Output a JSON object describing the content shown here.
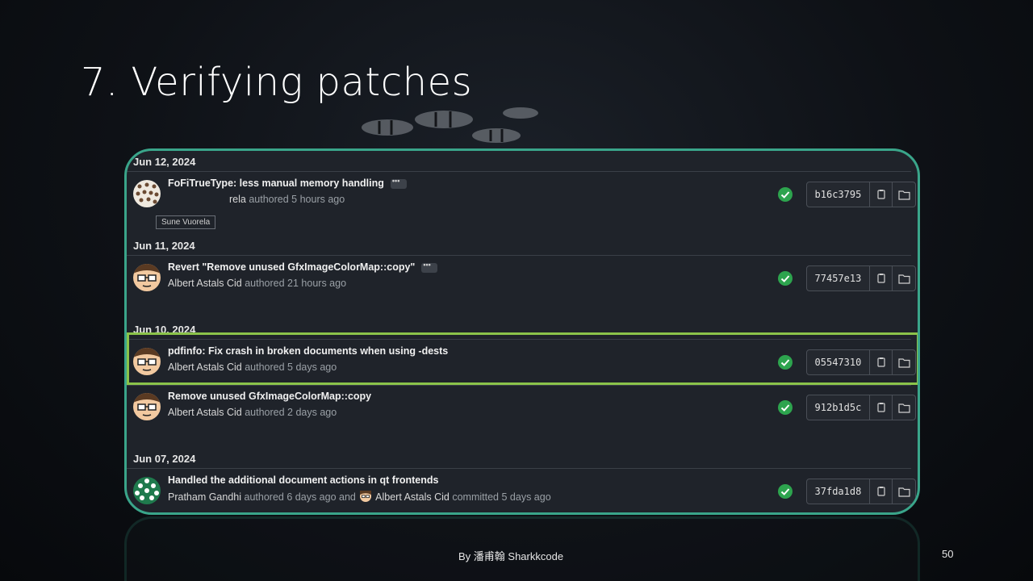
{
  "slide": {
    "title": "7. Verifying patches",
    "footer": "By 潘甫翰 Sharkkcode",
    "page_number": "50"
  },
  "tooltip": "Sune Vuorela",
  "groups": [
    {
      "date": "Jun 12, 2024",
      "commits": [
        {
          "message": "FoFiTrueType: less manual memory handling",
          "author": "Sune Vuorela",
          "author_visible": "rela",
          "verb": "authored",
          "time": "5 hours ago",
          "sha": "b16c3795",
          "has_more": true,
          "status": "passed"
        }
      ]
    },
    {
      "date": "Jun 11, 2024",
      "commits": [
        {
          "message": "Revert \"Remove unused GfxImageColorMap::copy\"",
          "author": "Albert Astals Cid",
          "verb": "authored",
          "time": "21 hours ago",
          "sha": "77457e13",
          "has_more": true,
          "status": "passed"
        }
      ]
    },
    {
      "date": "Jun 10, 2024",
      "commits": [
        {
          "message": "pdfinfo: Fix crash in broken documents when using -dests",
          "author": "Albert Astals Cid",
          "verb": "authored",
          "time": "5 days ago",
          "sha": "05547310",
          "has_more": false,
          "status": "passed",
          "highlighted": true
        },
        {
          "message": "Remove unused GfxImageColorMap::copy",
          "author": "Albert Astals Cid",
          "verb": "authored",
          "time": "2 days ago",
          "sha": "912b1d5c",
          "has_more": false,
          "status": "passed"
        }
      ]
    },
    {
      "date": "Jun 07, 2024",
      "commits": [
        {
          "message": "Handled the additional document actions in qt frontends",
          "author": "Pratham Gandhi",
          "verb": "authored",
          "time": "6 days ago",
          "joiner": "and",
          "committer": "Albert Astals Cid",
          "commit_verb": "committed",
          "commit_time": "5 days ago",
          "sha": "37fda1d8",
          "has_more": false,
          "status": "passed"
        }
      ]
    }
  ],
  "icons": {
    "status": "check-circle-icon",
    "copy": "copy-icon",
    "browse": "folder-icon",
    "more": "ellipsis-icon"
  },
  "colors": {
    "panel_border": "#3aa58a",
    "highlight_border": "#8bc34a",
    "check_green": "#2da44e"
  }
}
